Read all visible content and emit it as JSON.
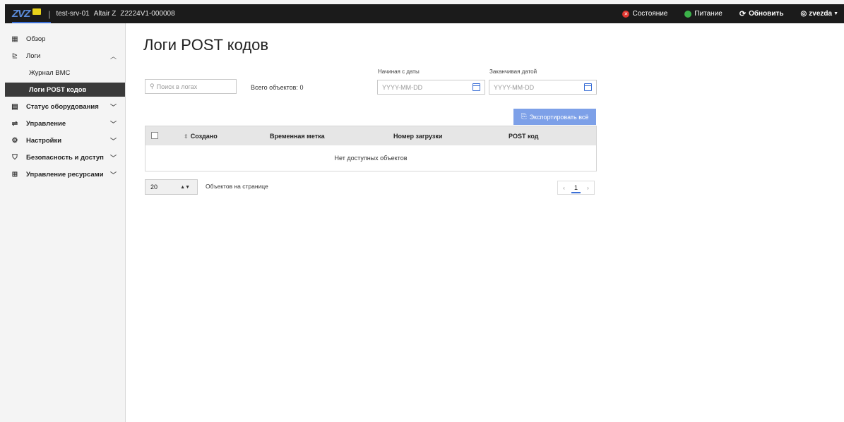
{
  "topbar": {
    "logo_text": "ZVZ",
    "server_name": "test-srv-01",
    "model": "Altair Z",
    "serial": "Z2224V1-000008",
    "status_label": "Состояние",
    "power_label": "Питание",
    "refresh_label": "Обновить",
    "user_label": "zvezda",
    "status_color": "#e0352e",
    "power_color": "#3cb34a"
  },
  "sidebar": {
    "items": [
      {
        "label": "Обзор",
        "icon": "dashboard-icon"
      },
      {
        "label": "Логи",
        "icon": "chart-icon",
        "expanded": true
      },
      {
        "label": "Журнал BMC",
        "sub": true
      },
      {
        "label": "Логи POST кодов",
        "sub": true,
        "active": true
      },
      {
        "label": "Статус оборудования",
        "icon": "clipboard-icon"
      },
      {
        "label": "Управление",
        "icon": "sliders-icon"
      },
      {
        "label": "Настройки",
        "icon": "gear-icon"
      },
      {
        "label": "Безопасность и доступ",
        "icon": "shield-icon"
      },
      {
        "label": "Управление ресурсами",
        "icon": "resources-icon"
      }
    ]
  },
  "main": {
    "title": "Логи POST кодов",
    "search_placeholder": "Поиск в логах",
    "total_label": "Всего объектов: 0",
    "from_date_label": "Начиная с даты",
    "to_date_label": "Заканчивая датой",
    "date_placeholder": "YYYY-MM-DD",
    "export_label": "Экспортировать всё",
    "table": {
      "columns": [
        "Создано",
        "Временная метка",
        "Номер загрузки",
        "POST код"
      ],
      "empty_text": "Нет доступных объектов"
    },
    "per_page_value": "20",
    "per_page_label": "Объектов на странице",
    "pagination": {
      "prev": "‹",
      "current": "1",
      "next": "›"
    }
  }
}
